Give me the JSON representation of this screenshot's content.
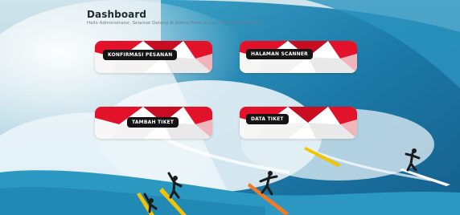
{
  "header": {
    "title": "Dashboard",
    "subtitle": "Hallo Administrator, Selamat Datang di Admin Panel Kalam Renang MC Maskam"
  },
  "cards": [
    {
      "label": "KONFIRMASI PESANAN"
    },
    {
      "label": "HALAMAN SCANNER"
    },
    {
      "label": "TAMBAH TIKET"
    },
    {
      "label": "DATA TIKET"
    }
  ],
  "colors": {
    "card_red": "#e3122b",
    "card_white": "#ffffff",
    "label_bg": "#141414",
    "wave_blue": "#1f79a5",
    "foam": "#eef6f9"
  },
  "icons": [
    "surfer-figure",
    "surfboard"
  ]
}
